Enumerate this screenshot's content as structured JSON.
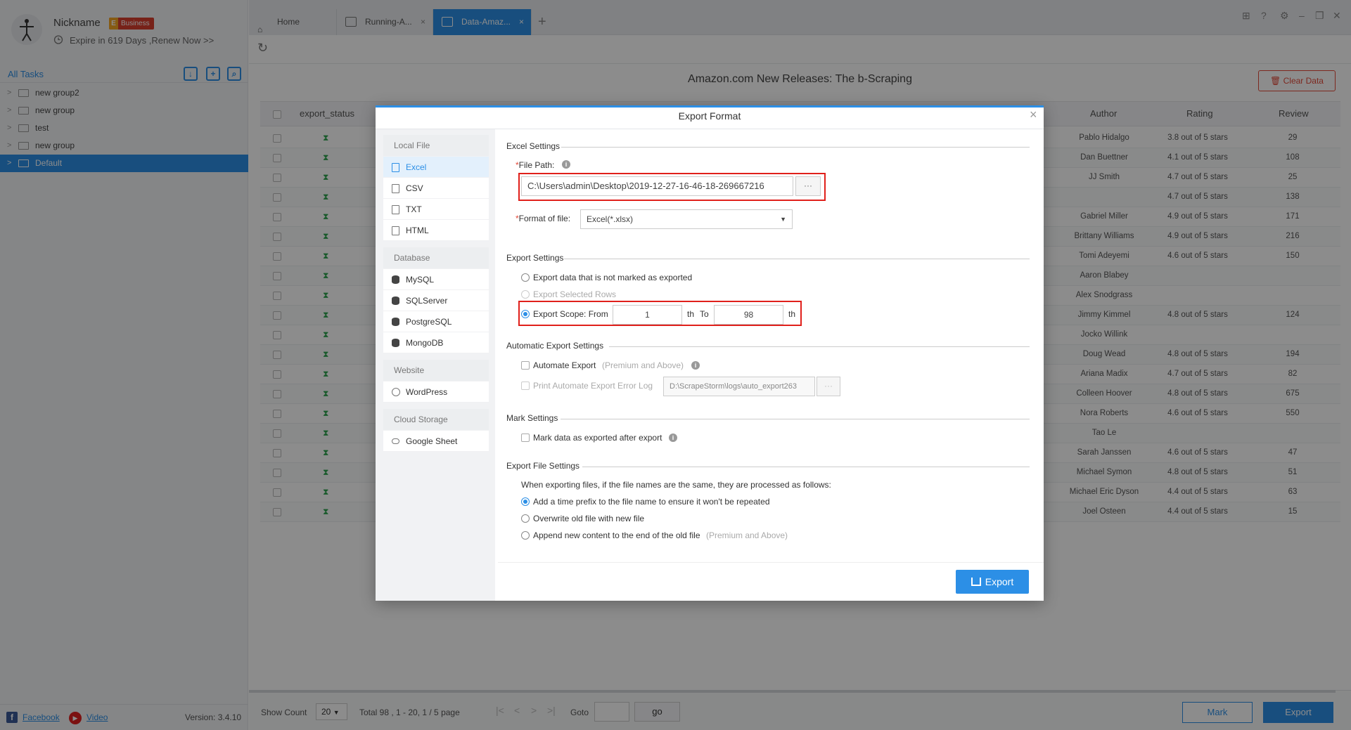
{
  "user": {
    "nickname": "Nickname",
    "badge_letter": "E",
    "badge": "Business",
    "expire": "Expire in 619 Days ,Renew Now >>"
  },
  "sidebar": {
    "all_tasks": "All Tasks",
    "groups": [
      {
        "label": "new group2",
        "selected": false
      },
      {
        "label": "new group",
        "selected": false
      },
      {
        "label": "test",
        "selected": false
      },
      {
        "label": "new group",
        "selected": false
      },
      {
        "label": "Default",
        "selected": true
      }
    ],
    "facebook": "Facebook",
    "video": "Video",
    "version": "Version: 3.4.10"
  },
  "tabs": [
    {
      "label": "Home",
      "active": false
    },
    {
      "label": "Running-A...",
      "active": false
    },
    {
      "label": "Data-Amaz...",
      "active": true
    }
  ],
  "main": {
    "title": "Amazon.com New Releases: The b-Scraping",
    "clear_data": "Clear Data",
    "columns": [
      "export_status",
      "Author",
      "Rating",
      "Review"
    ],
    "rows": [
      {
        "author": "Pablo Hidalgo",
        "rating": "3.8 out of 5 stars",
        "review": "29"
      },
      {
        "author": "Dan Buettner",
        "rating": "4.1 out of 5 stars",
        "review": "108"
      },
      {
        "author": "JJ Smith",
        "rating": "4.7 out of 5 stars",
        "review": "25"
      },
      {
        "author": "",
        "rating": "4.7 out of 5 stars",
        "review": "138"
      },
      {
        "author": "Gabriel Miller",
        "rating": "4.9 out of 5 stars",
        "review": "171"
      },
      {
        "author": "Brittany Williams",
        "rating": "4.9 out of 5 stars",
        "review": "216"
      },
      {
        "author": "Tomi Adeyemi",
        "rating": "4.6 out of 5 stars",
        "review": "150"
      },
      {
        "author": "Aaron Blabey",
        "rating": "",
        "review": ""
      },
      {
        "author": "Alex Snodgrass",
        "rating": "",
        "review": ""
      },
      {
        "author": "Jimmy Kimmel",
        "rating": "4.8 out of 5 stars",
        "review": "124"
      },
      {
        "author": "Jocko Willink",
        "rating": "",
        "review": ""
      },
      {
        "author": "Doug Wead",
        "rating": "4.8 out of 5 stars",
        "review": "194"
      },
      {
        "author": "Ariana Madix",
        "rating": "4.7 out of 5 stars",
        "review": "82"
      },
      {
        "author": "Colleen Hoover",
        "rating": "4.8 out of 5 stars",
        "review": "675"
      },
      {
        "author": "Nora Roberts",
        "rating": "4.6 out of 5 stars",
        "review": "550"
      },
      {
        "author": "Tao Le",
        "rating": "",
        "review": ""
      },
      {
        "author": "Sarah Janssen",
        "rating": "4.6 out of 5 stars",
        "review": "47"
      },
      {
        "author": "Michael Symon",
        "rating": "4.8 out of 5 stars",
        "review": "51"
      },
      {
        "author": "Michael Eric Dyson",
        "rating": "4.4 out of 5 stars",
        "review": "63"
      },
      {
        "author": "Joel Osteen",
        "rating": "4.4 out of 5 stars",
        "review": "15"
      }
    ]
  },
  "footer": {
    "show_count_label": "Show Count",
    "show_count": "20",
    "total": "Total 98 ,  1 - 20,  1 / 5  page",
    "goto": "Goto",
    "go": "go",
    "mark": "Mark",
    "export": "Export"
  },
  "modal": {
    "title": "Export Format",
    "left_sections": [
      {
        "title": "Local File",
        "items": [
          "Excel",
          "CSV",
          "TXT",
          "HTML"
        ]
      },
      {
        "title": "Database",
        "items": [
          "MySQL",
          "SQLServer",
          "PostgreSQL",
          "MongoDB"
        ]
      },
      {
        "title": "Website",
        "items": [
          "WordPress"
        ]
      },
      {
        "title": "Cloud Storage",
        "items": [
          "Google Sheet"
        ]
      }
    ],
    "excel_settings": "Excel Settings",
    "file_path_label": "File Path:",
    "file_path_value": "C:\\Users\\admin\\Desktop\\2019-12-27-16-46-18-269667216",
    "format_label": "Format of file:",
    "format_value": "Excel(*.xlsx)",
    "export_settings": "Export Settings",
    "opt_not_marked": "Export data that is not marked as exported",
    "opt_selected_rows": "Export Selected Rows",
    "opt_scope": "Export Scope: From",
    "scope_from": "1",
    "scope_th1": "th",
    "scope_to": "To",
    "scope_end": "98",
    "scope_th2": "th",
    "auto_settings": "Automatic Export Settings",
    "automate_export": "Automate Export",
    "automate_note": "(Premium and Above)",
    "print_error_log": "Print Automate Export Error Log",
    "log_path": "D:\\ScrapeStorm\\logs\\auto_export263",
    "mark_settings": "Mark Settings",
    "mark_after_export": "Mark data as exported after export",
    "file_settings": "Export File Settings",
    "file_settings_desc": "When exporting files, if the file names are the same, they are processed as follows:",
    "opt_time_prefix": "Add a time prefix to the file name to ensure it won't be repeated",
    "opt_overwrite": "Overwrite old file with new file",
    "opt_append": "Append new content to the end of the old file",
    "append_note": "(Premium and Above)",
    "export_button": "Export"
  }
}
